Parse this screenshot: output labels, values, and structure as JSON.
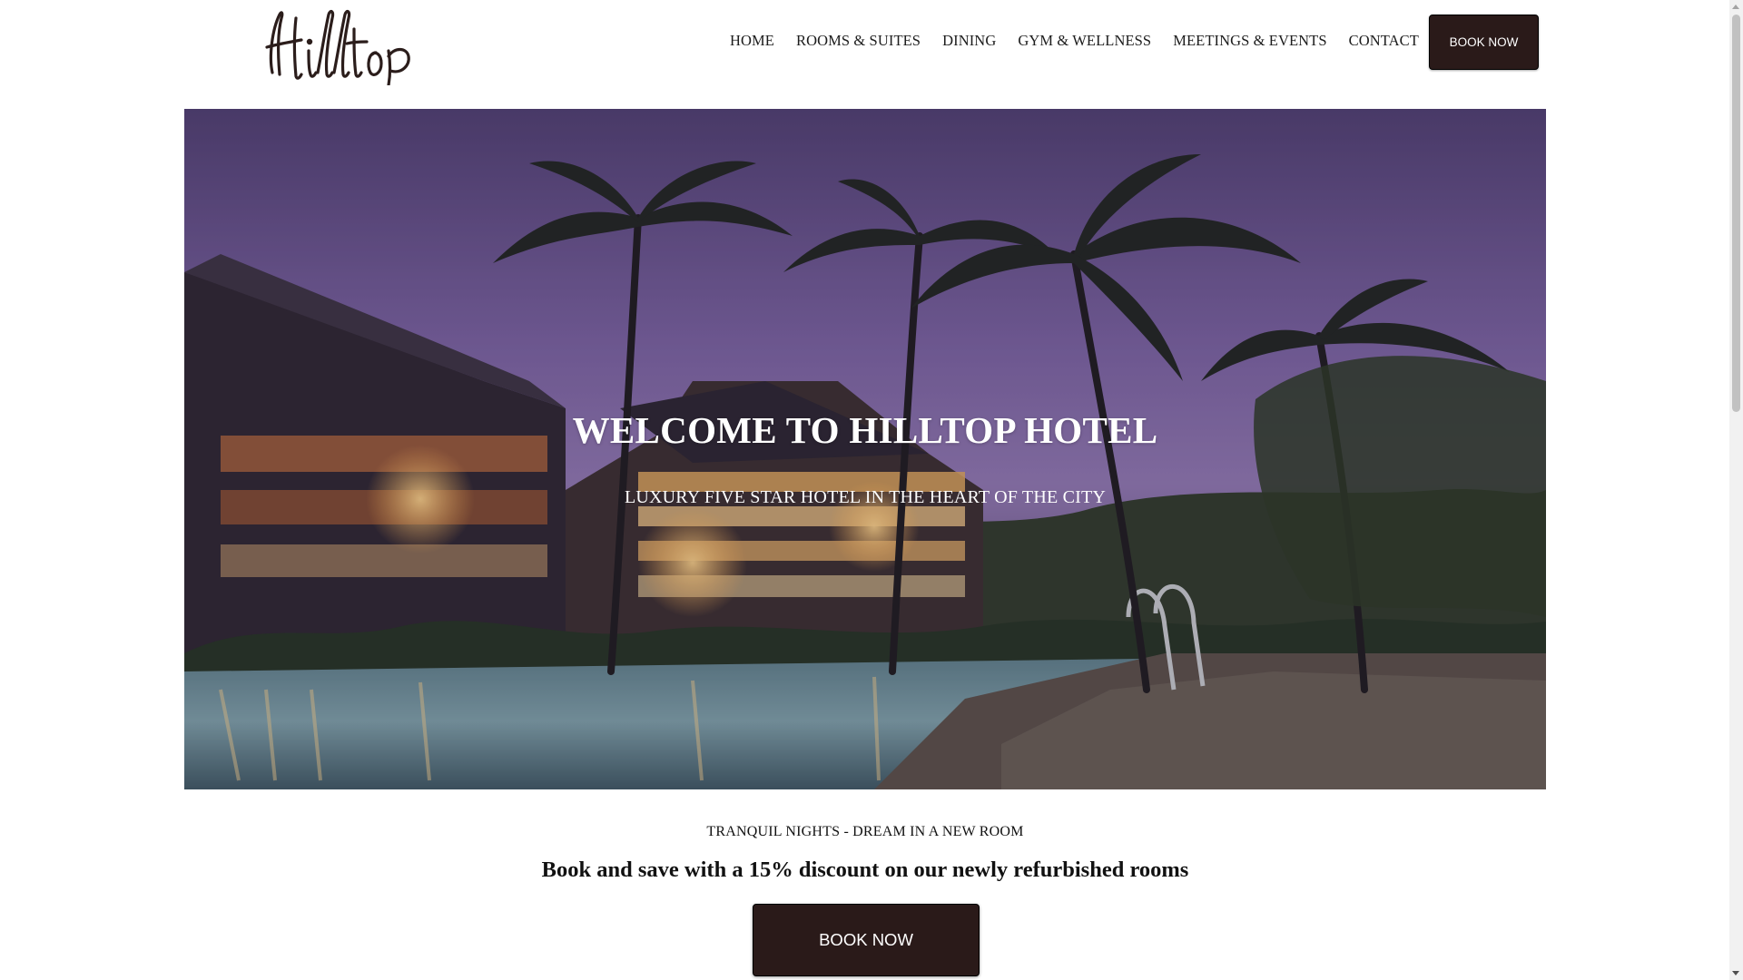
{
  "brand": {
    "logo_text": "Hilltop"
  },
  "nav": {
    "items": [
      {
        "label": "HOME"
      },
      {
        "label": "ROOMS & SUITES"
      },
      {
        "label": "DINING"
      },
      {
        "label": "GYM & WELLNESS"
      },
      {
        "label": "MEETINGS & EVENTS"
      },
      {
        "label": "CONTACT"
      }
    ],
    "book_button_label": "BOOK NOW"
  },
  "hero": {
    "title": "WELCOME TO HILLTOP HOTEL",
    "subtitle": "LUXURY FIVE STAR HOTEL IN THE HEART OF THE CITY"
  },
  "promo": {
    "eyebrow": "TRANQUIL NIGHTS - DREAM IN A NEW ROOM",
    "headline": "Book and save with a 15% discount on our newly refurbished rooms",
    "button_label": "BOOK NOW"
  },
  "colors": {
    "button_bg": "#2a1a19",
    "button_text": "#ffffff",
    "nav_text": "#1c1c1c",
    "hero_sky": "#7e67a4"
  },
  "icons": {
    "scroll_up": "chevron-up-icon",
    "scroll_down": "chevron-down-icon"
  }
}
